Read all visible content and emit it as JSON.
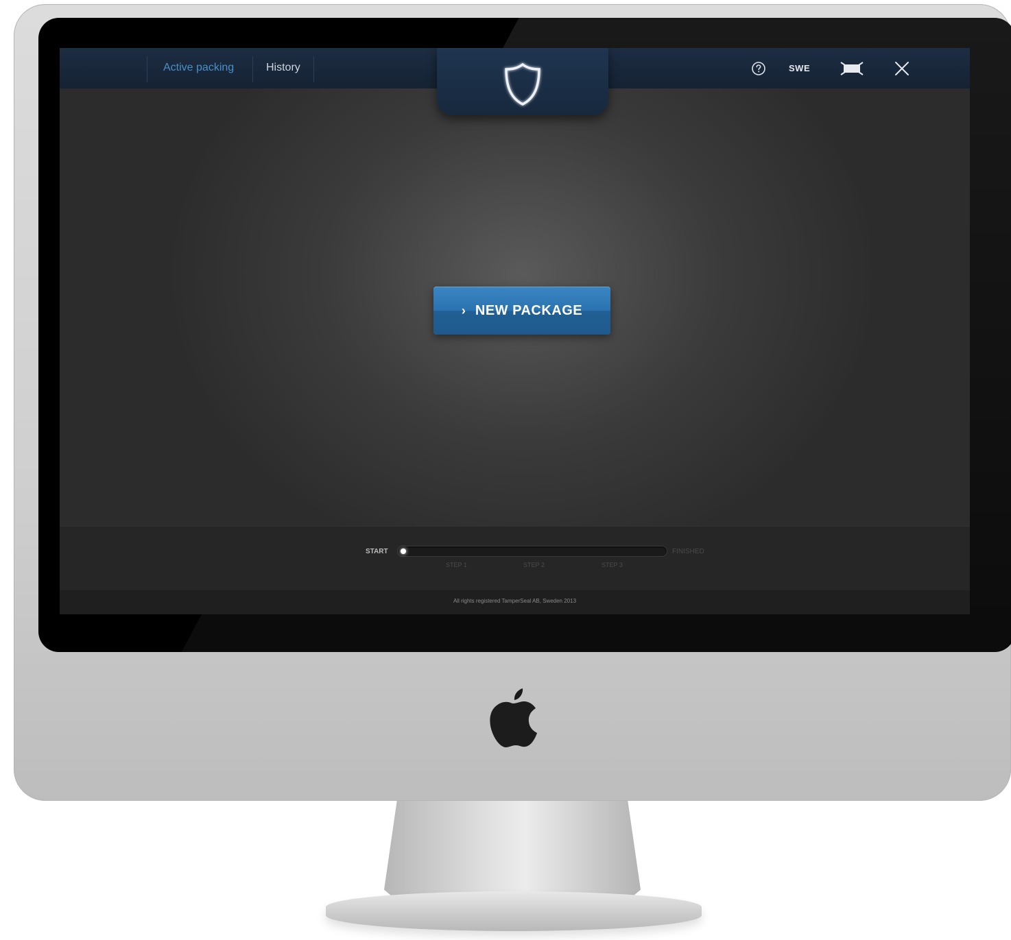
{
  "nav": {
    "items": [
      {
        "label": "Active packing",
        "active": true
      },
      {
        "label": "History",
        "active": false
      }
    ]
  },
  "header": {
    "logo_icon": "shield-icon",
    "help_icon": "question-circle-icon",
    "language": "SWE",
    "window_icon": "maximize-icon",
    "close_icon": "close-icon"
  },
  "main": {
    "new_package_label": "NEW PACKAGE",
    "new_package_icon": "chevron-right-icon"
  },
  "progress": {
    "start_label": "START",
    "finished_label": "FINISHED",
    "steps": [
      "STEP 1",
      "STEP 2",
      "STEP 3"
    ],
    "progress_fraction": 0.0
  },
  "footer": {
    "copyright": "All rights registered TamperSeal AB, Sweden 2013"
  },
  "colors": {
    "accent": "#2a73b0",
    "active_nav": "#4a90c8",
    "topbar": "#17283d",
    "background": "#3b3b3b"
  }
}
